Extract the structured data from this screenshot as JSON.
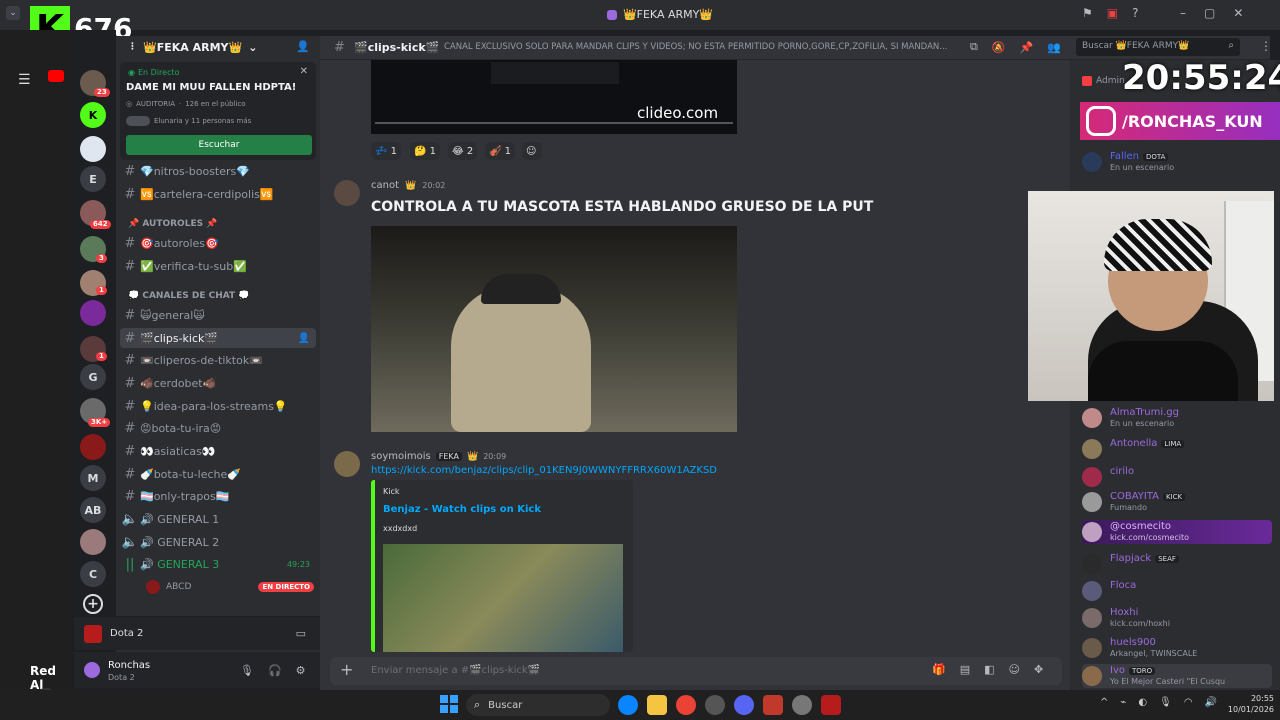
{
  "window": {
    "title": "👑FEKA ARMY👑"
  },
  "stream": {
    "kick_count": "676",
    "clock": "20:55:24",
    "instagram": "/RONCHAS_KUN",
    "overlay_label": "Red Al"
  },
  "server": {
    "name": "👑FEKA ARMY👑"
  },
  "stage": {
    "live_label": "En Directo",
    "title": "DAME MI MUU FALLEN HDPTA!",
    "audience": "AUDITORIA",
    "audience_count": "126 en el público",
    "listeners": "Elunaria y 11 personas más",
    "listen_button": "Escuchar"
  },
  "rail": {
    "badges": [
      "23",
      "642",
      "3",
      "1",
      "1",
      "3K+"
    ],
    "letters": [
      "E",
      "G",
      "M",
      "AB",
      "C"
    ]
  },
  "channels": {
    "top": [
      "💎nitros-boosters💎",
      "🆚cartelera-cerdipolis🆚"
    ],
    "cat_autoroles": "📌 AUTOROLES 📌",
    "autoroles": [
      "🎯autoroles🎯",
      "✅verifica-tu-sub✅"
    ],
    "cat_chat": "💭 CANALES DE CHAT 💭",
    "chat": [
      "🙀general🙀",
      "🎬clips-kick🎬",
      "📼cliperos-de-tiktok📼",
      "🐗cerdobet🐗",
      "💡idea-para-los-streams💡",
      "😡bota-tu-ira😡",
      "👀asiaticas👀",
      "🍼bota-tu-leche🍼",
      "🏳️‍⚧️only-trapos🏳️‍⚧️"
    ],
    "voice": [
      "🔊 GENERAL 1",
      "🔊 GENERAL 2",
      "🔊 GENERAL 3"
    ],
    "voice_time": "49:23",
    "voice_user": "ABCD",
    "live_badge": "EN DIRECTO"
  },
  "activity": {
    "game": "Dota 2"
  },
  "user": {
    "name": "Ronchas",
    "status": "Dota 2"
  },
  "header": {
    "channel": "🎬clips-kick🎬",
    "topic": "CANAL EXCLUSIVO SOLO PARA MANDAR CLIPS Y VIDEOS; NO ESTA PERMITIDO PORNO,GORE,CP,ZOFILIA, SI MANDAN...",
    "search_placeholder": "Buscar 👑FEKA ARMY👑"
  },
  "messages": [
    {
      "author": "canot",
      "time": "20:02",
      "text": "CONTROLA A TU MASCOTA ESTA HABLANDO GRUESO DE LA PUT"
    },
    {
      "author": "soymoimois",
      "tag": "FEKA",
      "time": "20:09",
      "link": "https://kick.com/benjaz/clips/clip_01KEN9J0WWNYFFRRX60W1AZKSD",
      "embed_site": "Kick",
      "embed_title": "Benjaz - Watch clips on Kick",
      "embed_desc": "xxdxdxd"
    }
  ],
  "video_watermark": "clideo.com",
  "reactions": [
    "💤 1",
    "🤔 1",
    "😂 2",
    "🎻 1"
  ],
  "composer": {
    "placeholder": "Enviar mensaje a #🎬clips-kick🎬"
  },
  "members": [
    {
      "name": "Fallen",
      "tag": "DOTA",
      "sub": "En un escenario",
      "color": "#5865f2"
    },
    {
      "name": "AlmaTrumi.gg",
      "tag": "",
      "sub": "En un escenario",
      "color": "#9c6ade"
    },
    {
      "name": "Antonella",
      "tag": "LIMA",
      "sub": "",
      "color": "#9c6ade"
    },
    {
      "name": "cirilo",
      "tag": "",
      "sub": "",
      "color": "#9c6ade"
    },
    {
      "name": "COBAYITA",
      "tag": "KICK",
      "sub": "Fumando",
      "color": "#9c6ade"
    },
    {
      "name": "@cosmecito",
      "tag": "",
      "sub": "kick.com/cosmecito",
      "color": "#c27cff"
    },
    {
      "name": "Flapjack",
      "tag": "SEAF",
      "sub": "",
      "color": "#9c6ade"
    },
    {
      "name": "Floca",
      "tag": "",
      "sub": "",
      "color": "#9c6ade"
    },
    {
      "name": "Hoxhi",
      "tag": "",
      "sub": "kick.com/hoxhi",
      "color": "#9c6ade"
    },
    {
      "name": "huels900",
      "tag": "",
      "sub": "Arkangel, TWINSCALE",
      "color": "#9c6ade"
    },
    {
      "name": "Ivo",
      "tag": "TORO",
      "sub": "Yo El Mejor Casteri \"El Cusqu",
      "color": "#9c6ade"
    }
  ],
  "member_header": "Admin",
  "taskbar": {
    "search": "Buscar",
    "time": "20:55",
    "date": "10/01/2026"
  },
  "colors": {
    "accent": "#5865f2",
    "green": "#23a55a",
    "live": "#f23f43",
    "kick": "#53fc18",
    "link": "#00a8fc"
  }
}
